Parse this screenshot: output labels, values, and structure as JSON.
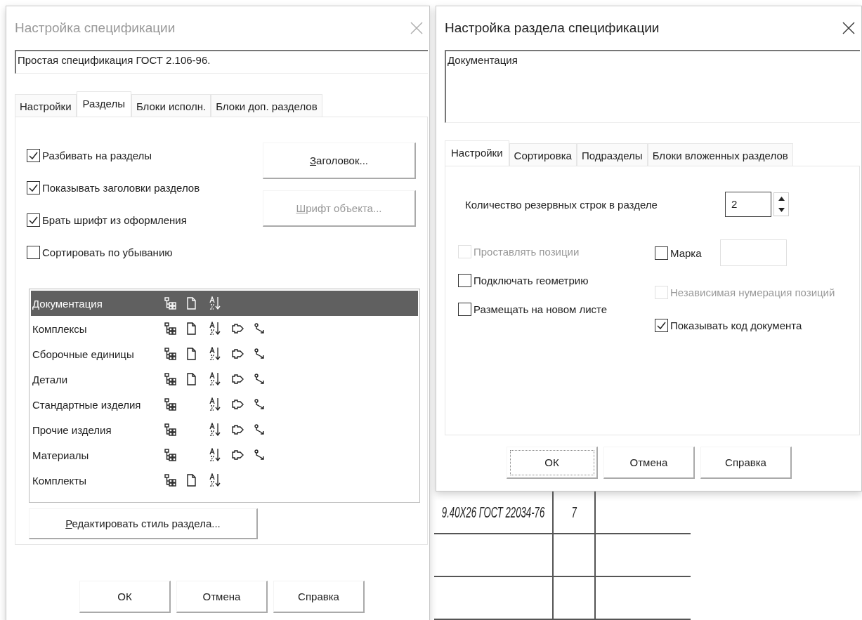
{
  "left_dialog": {
    "title": "Настройка спецификации",
    "active": false,
    "name_field": {
      "value": "Простая спецификация ГОСТ 2.106-96."
    },
    "tabs": [
      {
        "label": "Настройки",
        "selected": false
      },
      {
        "label": "Разделы",
        "selected": true
      },
      {
        "label": "Блоки исполн.",
        "selected": false
      },
      {
        "label": "Блоки доп. разделов",
        "selected": false
      }
    ],
    "checkboxes": [
      {
        "label": "Разбивать на разделы",
        "checked": true
      },
      {
        "label": "Показывать заголовки разделов",
        "checked": true
      },
      {
        "label": "Брать шрифт из оформления",
        "checked": true
      },
      {
        "label": "Сортировать по убыванию",
        "checked": false
      }
    ],
    "side_buttons": [
      {
        "label": "Заголовок...",
        "disabled": false
      },
      {
        "label": "Шрифт объекта...",
        "disabled": true
      }
    ],
    "sections": [
      {
        "name": "Документация",
        "selected": true,
        "page_icon": true,
        "link_icons": false
      },
      {
        "name": "Комплексы",
        "selected": false,
        "page_icon": true,
        "link_icons": true
      },
      {
        "name": "Сборочные единицы",
        "selected": false,
        "page_icon": true,
        "link_icons": true
      },
      {
        "name": "Детали",
        "selected": false,
        "page_icon": true,
        "link_icons": true
      },
      {
        "name": "Стандартные изделия",
        "selected": false,
        "page_icon": false,
        "link_icons": true
      },
      {
        "name": "Прочие изделия",
        "selected": false,
        "page_icon": false,
        "link_icons": true
      },
      {
        "name": "Материалы",
        "selected": false,
        "page_icon": false,
        "link_icons": true
      },
      {
        "name": "Комплекты",
        "selected": false,
        "page_icon": true,
        "link_icons": false
      }
    ],
    "edit_style_button": "Редактировать стиль раздела...",
    "buttons": [
      {
        "label": "ОК",
        "focused": false
      },
      {
        "label": "Отмена",
        "focused": false
      },
      {
        "label": "Справка",
        "focused": false
      }
    ]
  },
  "right_dialog": {
    "title": "Настройка раздела спецификации",
    "active": true,
    "name_field": {
      "value": "Документация"
    },
    "tabs": [
      {
        "label": "Настройки",
        "selected": true
      },
      {
        "label": "Сортировка",
        "selected": false
      },
      {
        "label": "Подразделы",
        "selected": false
      },
      {
        "label": "Блоки вложенных разделов",
        "selected": false
      }
    ],
    "reserve_rows": {
      "label": "Количество резервных строк в разделе",
      "value": "2"
    },
    "left_options": [
      {
        "kind": "checkbox",
        "label": "Проставлять позиции",
        "checked": false,
        "disabled": true
      },
      {
        "kind": "checkbox",
        "label": "Подключать геометрию",
        "checked": false,
        "disabled": false
      },
      {
        "kind": "checkbox",
        "label": "Размещать на новом листе",
        "checked": false,
        "disabled": false
      }
    ],
    "right_options": [
      {
        "kind": "checkbox_field",
        "label": "Марка",
        "checked": false,
        "disabled": false
      },
      {
        "kind": "checkbox",
        "label": "Независимая нумерация позиций",
        "checked": false,
        "disabled": true
      },
      {
        "kind": "checkbox",
        "label": "Показывать код документа",
        "checked": true,
        "disabled": false
      }
    ],
    "buttons": [
      {
        "label": "ОК",
        "focused": true
      },
      {
        "label": "Отмена",
        "focused": false
      },
      {
        "label": "Справка",
        "focused": false
      }
    ]
  },
  "background_table": {
    "rows": [
      [
        "9.40Х26 ГОСТ 22034-76",
        "7",
        ""
      ],
      [
        "",
        "",
        ""
      ],
      [
        "",
        "",
        ""
      ]
    ]
  }
}
